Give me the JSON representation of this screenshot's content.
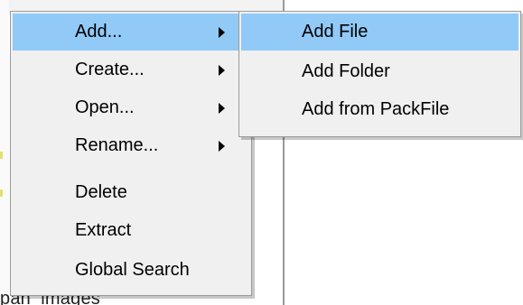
{
  "background": {
    "partial_text": "pan_images"
  },
  "context_menu": {
    "items": [
      {
        "label": "Add...",
        "has_submenu": true,
        "highlighted": true
      },
      {
        "label": "Create...",
        "has_submenu": true,
        "highlighted": false
      },
      {
        "label": "Open...",
        "has_submenu": true,
        "highlighted": false
      },
      {
        "label": "Rename...",
        "has_submenu": true,
        "highlighted": false
      },
      {
        "label": "Delete",
        "has_submenu": false,
        "highlighted": false
      },
      {
        "label": "Extract",
        "has_submenu": false,
        "highlighted": false
      },
      {
        "label": "Global Search",
        "has_submenu": false,
        "highlighted": false
      }
    ]
  },
  "submenu": {
    "parent": "Add...",
    "items": [
      {
        "label": "Add File",
        "highlighted": true
      },
      {
        "label": "Add Folder",
        "highlighted": false
      },
      {
        "label": "Add from PackFile",
        "highlighted": false
      }
    ]
  },
  "colors": {
    "menu_background": "#f0f0f0",
    "highlight": "#91c9f7",
    "border": "#9a9a9a",
    "text": "#000000"
  },
  "icons": {
    "submenu_arrow": "submenu-arrow-icon"
  }
}
